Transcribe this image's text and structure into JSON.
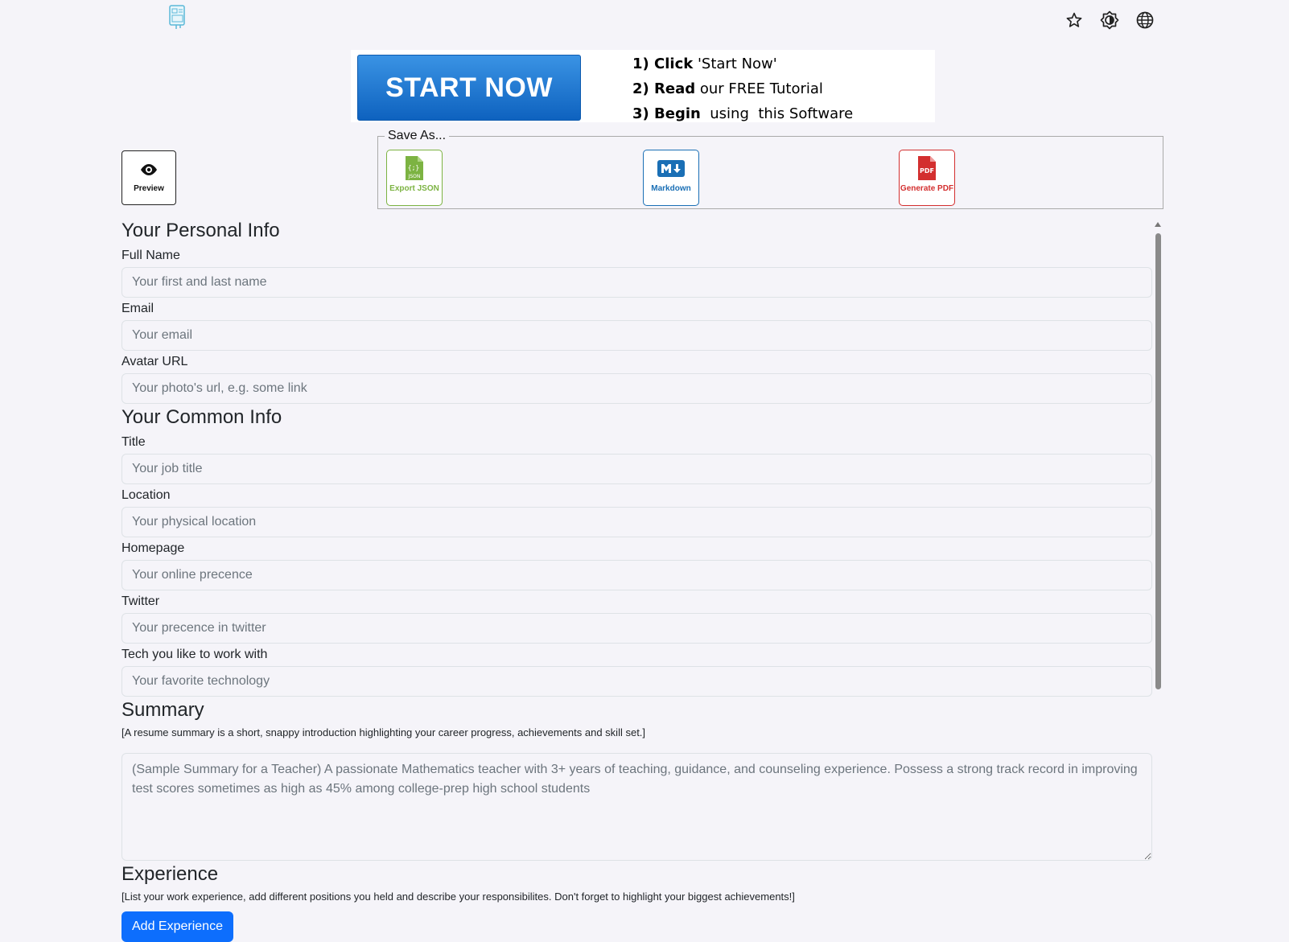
{
  "header": {
    "logo_icon": "resume-document-icon",
    "icons": [
      "star-icon",
      "theme-contrast-icon",
      "globe-icon"
    ]
  },
  "banner": {
    "button_label": "START NOW",
    "steps": [
      {
        "bold": "1) Click",
        "rest": " 'Start Now'"
      },
      {
        "bold": "2) Read",
        "rest": " our FREE Tutorial"
      },
      {
        "bold": "3) Begin",
        "rest": "  using  this Software"
      }
    ]
  },
  "toolbar": {
    "preview_label": "Preview",
    "save_as_legend": "Save As...",
    "export_json_label": "Export JSON",
    "markdown_label": "Markdown",
    "pdf_label": "Generate PDF",
    "colors": {
      "json": "#7cb342",
      "markdown": "#1a6fb5",
      "pdf": "#d32f2f"
    }
  },
  "personal": {
    "title": "Your Personal Info",
    "full_name_label": "Full Name",
    "full_name_placeholder": "Your first and last name",
    "email_label": "Email",
    "email_placeholder": "Your email",
    "avatar_label": "Avatar URL",
    "avatar_placeholder": "Your photo's url, e.g. some link"
  },
  "common": {
    "title": "Your Common Info",
    "title_label": "Title",
    "title_placeholder": "Your job title",
    "location_label": "Location",
    "location_placeholder": "Your physical location",
    "homepage_label": "Homepage",
    "homepage_placeholder": "Your online precence",
    "twitter_label": "Twitter",
    "twitter_placeholder": "Your precence in twitter",
    "tech_label": "Tech you like to work with",
    "tech_placeholder": "Your favorite technology"
  },
  "summary": {
    "title": "Summary",
    "hint": "[A resume summary is a short, snappy introduction highlighting your career progress, achievements and skill set.]",
    "placeholder": "(Sample Summary for a Teacher) A passionate Mathematics teacher with 3+ years of teaching, guidance, and counseling experience. Possess a strong track record in improving test scores sometimes as high as 45% among college-prep high school students"
  },
  "experience": {
    "title": "Experience",
    "hint": "[List your work experience, add different positions you held and describe your responsibilites. Don't forget to highlight your biggest achievements!]",
    "add_label": "Add Experience"
  },
  "accent_color": "#0d6efd"
}
